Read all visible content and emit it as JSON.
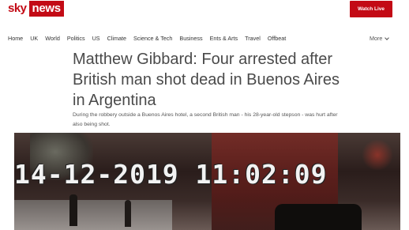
{
  "header": {
    "logo": {
      "sky": "sky",
      "news": "news"
    },
    "watch_live": "Watch Live",
    "brand_color": "#c30a15"
  },
  "nav": {
    "items": [
      "Home",
      "UK",
      "World",
      "Politics",
      "US",
      "Climate",
      "Science & Tech",
      "Business",
      "Ents & Arts",
      "Travel",
      "Offbeat"
    ],
    "more_label": "More"
  },
  "article": {
    "title": "Matthew Gibbard: Four arrested after British man shot dead in Buenos Aires in Argentina",
    "standfirst": "During the robbery outside a Buenos Aires hotel, a second British man - his 28-year-old stepson - was hurt after also being shot.",
    "image": {
      "timestamp": "14-12-2019 11:02:09"
    }
  }
}
